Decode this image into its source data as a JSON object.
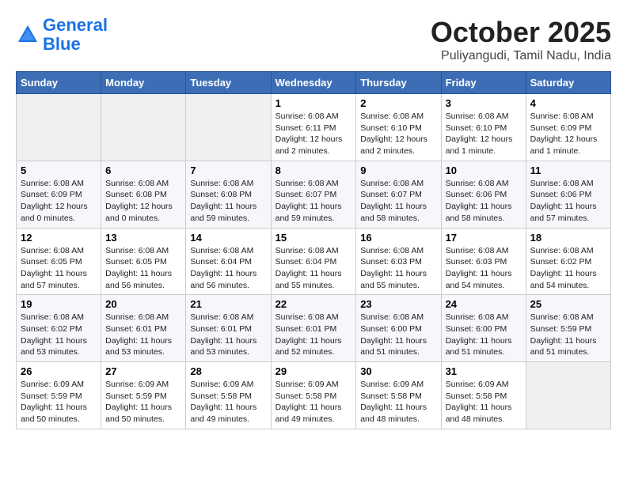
{
  "header": {
    "logo_line1": "General",
    "logo_line2": "Blue",
    "month": "October 2025",
    "location": "Puliyangudi, Tamil Nadu, India"
  },
  "weekdays": [
    "Sunday",
    "Monday",
    "Tuesday",
    "Wednesday",
    "Thursday",
    "Friday",
    "Saturday"
  ],
  "weeks": [
    [
      {
        "day": "",
        "info": ""
      },
      {
        "day": "",
        "info": ""
      },
      {
        "day": "",
        "info": ""
      },
      {
        "day": "1",
        "info": "Sunrise: 6:08 AM\nSunset: 6:11 PM\nDaylight: 12 hours and 2 minutes."
      },
      {
        "day": "2",
        "info": "Sunrise: 6:08 AM\nSunset: 6:10 PM\nDaylight: 12 hours and 2 minutes."
      },
      {
        "day": "3",
        "info": "Sunrise: 6:08 AM\nSunset: 6:10 PM\nDaylight: 12 hours and 1 minute."
      },
      {
        "day": "4",
        "info": "Sunrise: 6:08 AM\nSunset: 6:09 PM\nDaylight: 12 hours and 1 minute."
      }
    ],
    [
      {
        "day": "5",
        "info": "Sunrise: 6:08 AM\nSunset: 6:09 PM\nDaylight: 12 hours and 0 minutes."
      },
      {
        "day": "6",
        "info": "Sunrise: 6:08 AM\nSunset: 6:08 PM\nDaylight: 12 hours and 0 minutes."
      },
      {
        "day": "7",
        "info": "Sunrise: 6:08 AM\nSunset: 6:08 PM\nDaylight: 11 hours and 59 minutes."
      },
      {
        "day": "8",
        "info": "Sunrise: 6:08 AM\nSunset: 6:07 PM\nDaylight: 11 hours and 59 minutes."
      },
      {
        "day": "9",
        "info": "Sunrise: 6:08 AM\nSunset: 6:07 PM\nDaylight: 11 hours and 58 minutes."
      },
      {
        "day": "10",
        "info": "Sunrise: 6:08 AM\nSunset: 6:06 PM\nDaylight: 11 hours and 58 minutes."
      },
      {
        "day": "11",
        "info": "Sunrise: 6:08 AM\nSunset: 6:06 PM\nDaylight: 11 hours and 57 minutes."
      }
    ],
    [
      {
        "day": "12",
        "info": "Sunrise: 6:08 AM\nSunset: 6:05 PM\nDaylight: 11 hours and 57 minutes."
      },
      {
        "day": "13",
        "info": "Sunrise: 6:08 AM\nSunset: 6:05 PM\nDaylight: 11 hours and 56 minutes."
      },
      {
        "day": "14",
        "info": "Sunrise: 6:08 AM\nSunset: 6:04 PM\nDaylight: 11 hours and 56 minutes."
      },
      {
        "day": "15",
        "info": "Sunrise: 6:08 AM\nSunset: 6:04 PM\nDaylight: 11 hours and 55 minutes."
      },
      {
        "day": "16",
        "info": "Sunrise: 6:08 AM\nSunset: 6:03 PM\nDaylight: 11 hours and 55 minutes."
      },
      {
        "day": "17",
        "info": "Sunrise: 6:08 AM\nSunset: 6:03 PM\nDaylight: 11 hours and 54 minutes."
      },
      {
        "day": "18",
        "info": "Sunrise: 6:08 AM\nSunset: 6:02 PM\nDaylight: 11 hours and 54 minutes."
      }
    ],
    [
      {
        "day": "19",
        "info": "Sunrise: 6:08 AM\nSunset: 6:02 PM\nDaylight: 11 hours and 53 minutes."
      },
      {
        "day": "20",
        "info": "Sunrise: 6:08 AM\nSunset: 6:01 PM\nDaylight: 11 hours and 53 minutes."
      },
      {
        "day": "21",
        "info": "Sunrise: 6:08 AM\nSunset: 6:01 PM\nDaylight: 11 hours and 53 minutes."
      },
      {
        "day": "22",
        "info": "Sunrise: 6:08 AM\nSunset: 6:01 PM\nDaylight: 11 hours and 52 minutes."
      },
      {
        "day": "23",
        "info": "Sunrise: 6:08 AM\nSunset: 6:00 PM\nDaylight: 11 hours and 51 minutes."
      },
      {
        "day": "24",
        "info": "Sunrise: 6:08 AM\nSunset: 6:00 PM\nDaylight: 11 hours and 51 minutes."
      },
      {
        "day": "25",
        "info": "Sunrise: 6:08 AM\nSunset: 5:59 PM\nDaylight: 11 hours and 51 minutes."
      }
    ],
    [
      {
        "day": "26",
        "info": "Sunrise: 6:09 AM\nSunset: 5:59 PM\nDaylight: 11 hours and 50 minutes."
      },
      {
        "day": "27",
        "info": "Sunrise: 6:09 AM\nSunset: 5:59 PM\nDaylight: 11 hours and 50 minutes."
      },
      {
        "day": "28",
        "info": "Sunrise: 6:09 AM\nSunset: 5:58 PM\nDaylight: 11 hours and 49 minutes."
      },
      {
        "day": "29",
        "info": "Sunrise: 6:09 AM\nSunset: 5:58 PM\nDaylight: 11 hours and 49 minutes."
      },
      {
        "day": "30",
        "info": "Sunrise: 6:09 AM\nSunset: 5:58 PM\nDaylight: 11 hours and 48 minutes."
      },
      {
        "day": "31",
        "info": "Sunrise: 6:09 AM\nSunset: 5:58 PM\nDaylight: 11 hours and 48 minutes."
      },
      {
        "day": "",
        "info": ""
      }
    ]
  ]
}
